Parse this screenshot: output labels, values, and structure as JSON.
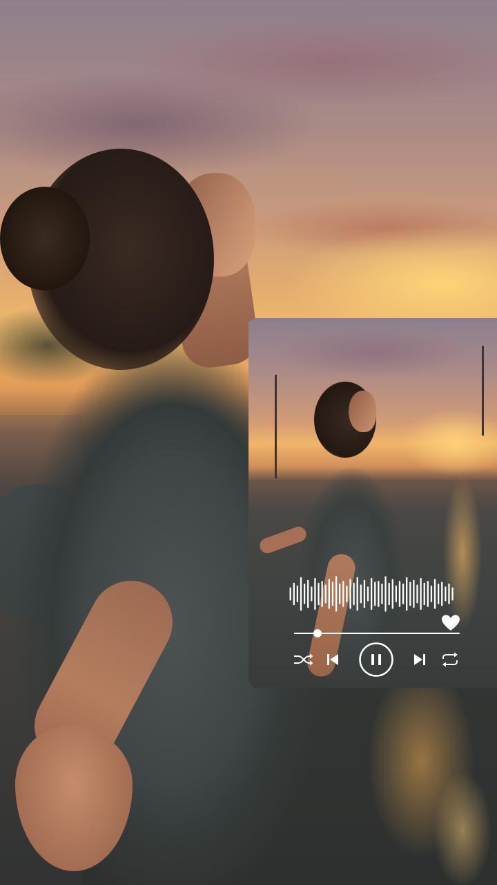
{
  "player": {
    "state": "playing",
    "progress": 0.14,
    "liked": true,
    "controls": [
      "shuffle",
      "previous",
      "pause",
      "next",
      "repeat"
    ],
    "icons": {
      "shuffle": "shuffle-icon",
      "previous": "skip-previous-icon",
      "pause": "pause-icon",
      "next": "skip-next-icon",
      "repeat": "repeat-icon",
      "like": "heart-icon"
    },
    "waveform": [
      0.35,
      0.6,
      0.45,
      0.9,
      0.55,
      0.75,
      0.4,
      0.85,
      0.6,
      0.7,
      0.5,
      0.8,
      0.65,
      0.95,
      0.55,
      0.7,
      0.45,
      0.8,
      0.6,
      0.9,
      0.5,
      0.75,
      0.4,
      0.85,
      0.65,
      0.7,
      0.55,
      0.95,
      0.6,
      0.8,
      0.45,
      0.7,
      0.55,
      0.9,
      0.65,
      0.75,
      0.5,
      0.85,
      0.6,
      0.7,
      0.45,
      0.8,
      0.55,
      0.65,
      0.4,
      0.55,
      0.35
    ]
  },
  "colors": {
    "control": "#ffffff",
    "sky_top": "#8f7f8c",
    "sunset": "#f1bd6d"
  }
}
